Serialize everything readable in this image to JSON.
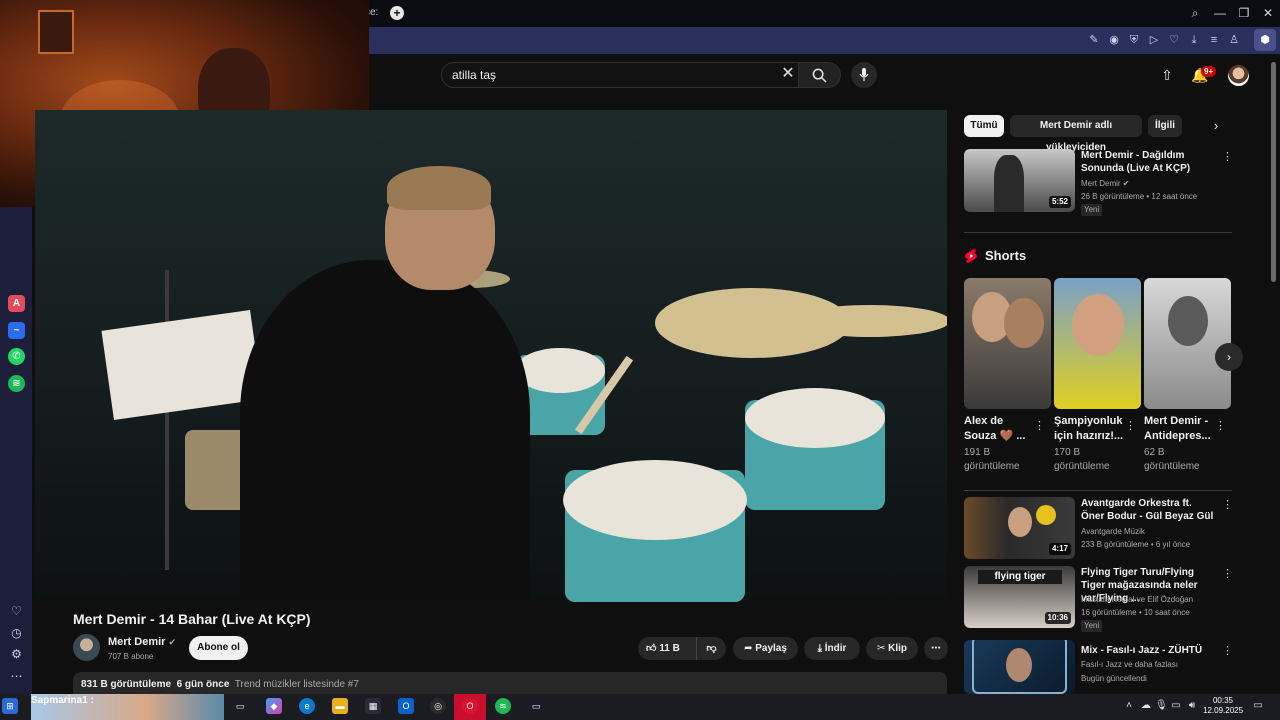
{
  "browser": {
    "tab_fragment": "ce:",
    "new_tab": "+",
    "win_search": "⌕",
    "win_min": "—",
    "win_restore": "❐",
    "win_close": "✕"
  },
  "youtube": {
    "search_value": "atilla taş",
    "notification_count": "9+",
    "video": {
      "title": "Mert Demir - 14 Bahar (Live At KÇP)",
      "channel": "Mert Demir",
      "subscribers": "707 B abone",
      "subscribe_label": "Abone ol",
      "likes": "11 B",
      "share_label": "Paylaş",
      "download_label": "İndir",
      "clip_label": "Klip",
      "views": "831 B görüntüleme",
      "age": "6 gün önce",
      "trend": "Trend müzikler listesinde #7"
    },
    "chips": [
      "Tümü",
      "Mert Demir adlı yükleyiciden",
      "İlgili"
    ],
    "related_top": {
      "title": "Mert Demir - Dağıldım Sonunda (Live At KÇP)",
      "channel": "Mert Demir",
      "meta": "26 B görüntüleme • 12 saat önce",
      "badge": "Yeni",
      "duration": "5:52"
    },
    "shorts_heading": "Shorts",
    "shorts": [
      {
        "title": "Alex de Souza 🤎 ...",
        "views": "191 B görüntüleme"
      },
      {
        "title": "Şampiyonluk için hazırız!...",
        "views": "170 B görüntüleme"
      },
      {
        "title": "Mert Demir - Antidepres...",
        "views": "62 B görüntüleme"
      }
    ],
    "related": [
      {
        "title": "Avantgarde Orkestra ft. Öner Bodur - Gül Beyaz Gül",
        "channel": "Avantgarde Müzik",
        "meta": "233 B görüntüleme • 6 yıl önce",
        "duration": "4:17",
        "badge": ""
      },
      {
        "title": "Flying Tiger Turu/Flying Tiger mağazasında neler var/Flying ...",
        "channel": "Mustafa Kemal ve Elif Özdoğan",
        "meta": "16 görüntüleme • 10 saat önce",
        "duration": "10:36",
        "badge": "Yeni",
        "thumb_text": "flying tiger"
      },
      {
        "title": "Mix - Fasıl-ı Jazz - ZÜHTÜ",
        "channel": "Fasıl-ı Jazz ve daha fazlası",
        "meta": "Bugün güncellendi",
        "duration": "",
        "badge": ""
      }
    ]
  },
  "taskbar": {
    "label": "Sapmarina1 :",
    "time": "00:35",
    "date": "12.09.2025"
  },
  "colors": {
    "sidebar_bg": "#1d1f3a",
    "address_bar_bg": "#2b2f5c",
    "yt_bg": "#0f0f0f",
    "shorts_red": "#ff0033"
  }
}
